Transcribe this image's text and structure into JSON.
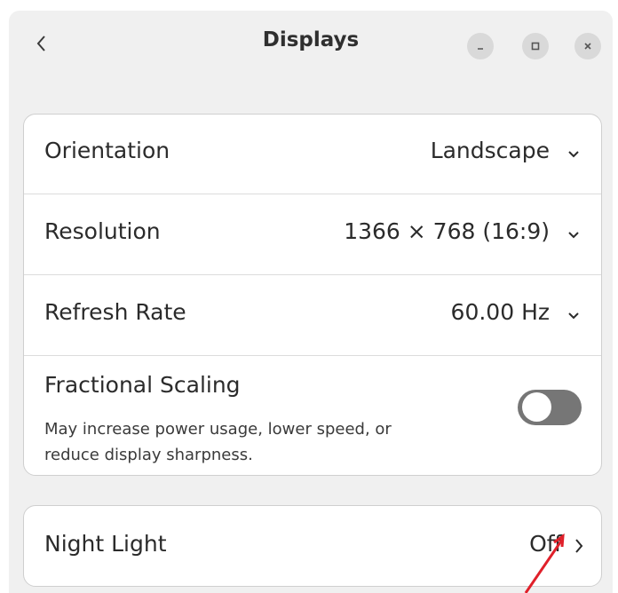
{
  "window": {
    "title": "Displays"
  },
  "icons": {
    "back": "chevron-left-icon",
    "minimize": "minimize-icon",
    "maximize": "maximize-icon",
    "close": "close-icon",
    "dropdown": "chevron-down-icon",
    "navigate": "chevron-right-icon"
  },
  "settings": {
    "orientation": {
      "label": "Orientation",
      "value": "Landscape"
    },
    "resolution": {
      "label": "Resolution",
      "value": "1366 × 768 (16:9)"
    },
    "refresh_rate": {
      "label": "Refresh Rate",
      "value": "60.00 Hz"
    },
    "fractional_scaling": {
      "label": "Fractional Scaling",
      "description_line1": "May increase power usage, lower speed, or",
      "description_line2": "reduce display sharpness.",
      "enabled": false
    },
    "night_light": {
      "label": "Night Light",
      "value": "Off"
    }
  },
  "colors": {
    "window_bg": "#f0f0f0",
    "card_bg": "#ffffff",
    "toggle_off": "#767676",
    "annotation_arrow": "#e0202a"
  }
}
